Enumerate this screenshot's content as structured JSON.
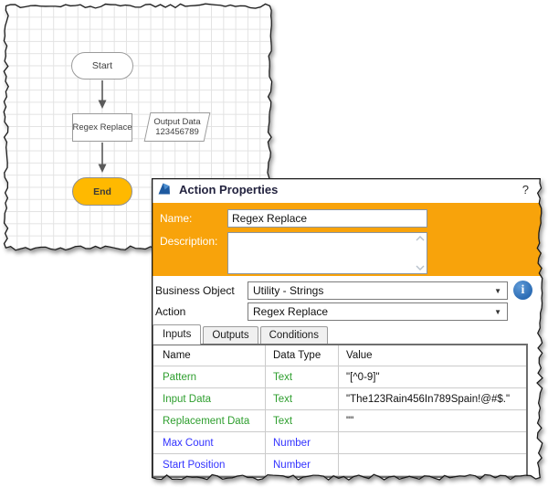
{
  "flowchart": {
    "start_label": "Start",
    "action_label": "Regex Replace",
    "data_item": {
      "line1": "Output Data",
      "line2": "123456789"
    },
    "end_label": "End"
  },
  "dialog": {
    "title": "Action Properties",
    "help": "?",
    "name_label": "Name:",
    "name_value": "Regex Replace",
    "description_label": "Description:",
    "description_value": "",
    "business_object_label": "Business Object",
    "business_object_value": "Utility - Strings",
    "action_label": "Action",
    "action_value": "Regex Replace",
    "dropdown_arrow_glyph": "▼",
    "info_icon_glyph": "i",
    "tabs": [
      {
        "label": "Inputs",
        "active": true
      },
      {
        "label": "Outputs",
        "active": false
      },
      {
        "label": "Conditions",
        "active": false
      }
    ],
    "table": {
      "headers": [
        "Name",
        "Data Type",
        "Value"
      ],
      "rows": [
        {
          "name": "Pattern",
          "data_type": "Text",
          "value": "\"[^0-9]\"",
          "type_color": "green"
        },
        {
          "name": "Input Data",
          "data_type": "Text",
          "value": "\"The123Rain456In789Spain!@#$.\"",
          "type_color": "green"
        },
        {
          "name": "Replacement Data",
          "data_type": "Text",
          "value": "\"\"",
          "type_color": "green"
        },
        {
          "name": "Max Count",
          "data_type": "Number",
          "value": "",
          "type_color": "blue"
        },
        {
          "name": "Start Position",
          "data_type": "Number",
          "value": "",
          "type_color": "blue"
        }
      ]
    },
    "colors": {
      "accent_orange": "#F8A30B",
      "type_text_green": "#2E9E2E",
      "type_number_blue": "#3333FF",
      "info_icon_blue": "#2C6CB4",
      "end_node_orange": "#FFB900"
    }
  }
}
